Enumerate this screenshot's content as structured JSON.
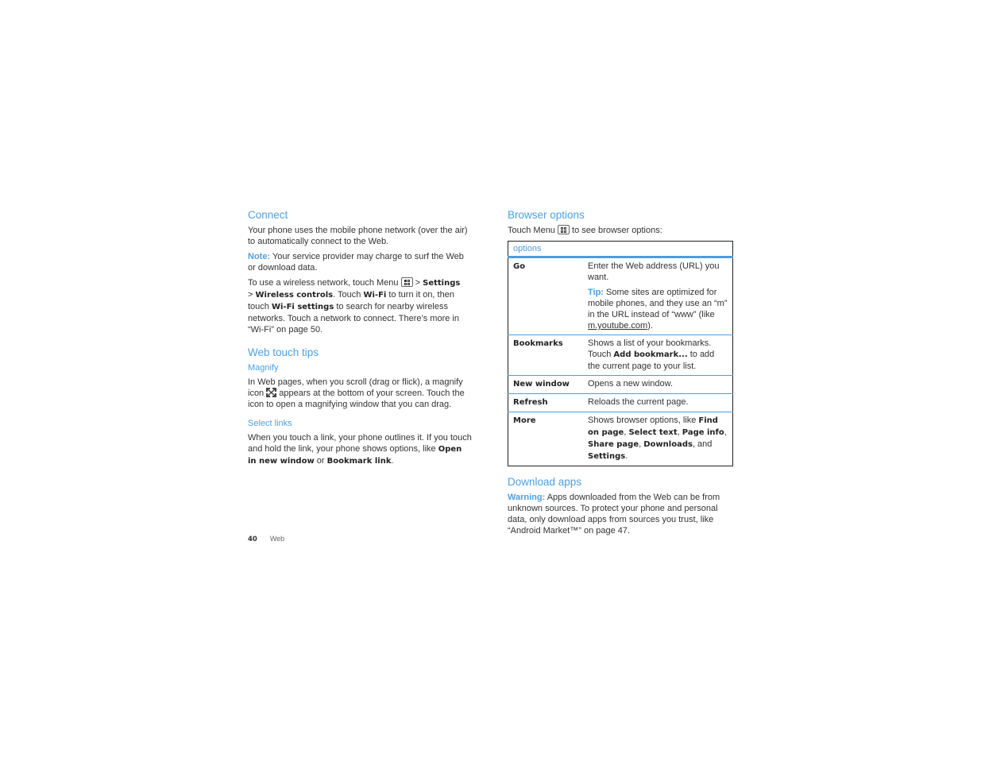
{
  "left": {
    "connect": {
      "heading": "Connect",
      "p1": "Your phone uses the mobile phone network (over the air) to automatically connect to the Web.",
      "note_label": "Note:",
      "note_text": " Your service provider may charge to surf the Web or download data.",
      "p3": {
        "t1": "To use a wireless network, touch Menu ",
        "t2": " > ",
        "b1": "Settings",
        "t3": " > ",
        "b2": "Wireless controls",
        "t4": ". Touch ",
        "b3": "Wi-Fi",
        "t5": " to turn it on, then touch ",
        "b4": "Wi-Fi settings",
        "t6": " to search for nearby wireless networks. Touch a network to connect. There’s more in “Wi-Fi” on page 50."
      }
    },
    "web_touch_tips": {
      "heading": "Web touch tips",
      "magnify": {
        "heading": "Magnify",
        "t1": "In Web pages, when you scroll (drag or flick), a magnify icon ",
        "t2": " appears at the bottom of your screen. Touch the icon to open a magnifying window that you can drag."
      },
      "select_links": {
        "heading": "Select links",
        "t1": "When you touch a link, your phone outlines it. If you touch and hold the link, your phone shows options, like ",
        "b1": "Open in new window",
        "t2": " or ",
        "b2": "Bookmark link",
        "t3": "."
      }
    }
  },
  "right": {
    "browser_options": {
      "heading": "Browser options",
      "intro1": "Touch Menu ",
      "intro2": " to see browser options:",
      "table": {
        "header": "options",
        "rows": [
          {
            "option": "Go",
            "desc": "Enter the Web address (URL) you want.",
            "tip_label": "Tip:",
            "tip_text": " Some sites are optimized for mobile phones, and they use an “m” in the URL instead of “www” (like ",
            "tip_link": "m.youtube.com",
            "tip_end": ")."
          },
          {
            "option": "Bookmarks",
            "d1": "Shows a list of your bookmarks. Touch ",
            "b1": "Add bookmark...",
            "d2": " to add the current page to your list."
          },
          {
            "option": "New window",
            "desc": "Opens a new window."
          },
          {
            "option": "Refresh",
            "desc": "Reloads the current page."
          },
          {
            "option": "More",
            "d1": "Shows browser options, like ",
            "b1": "Find on page",
            "s1": ", ",
            "b2": "Select text",
            "s2": ", ",
            "b3": "Page info",
            "s3": ", ",
            "b4": "Share page",
            "s4": ", ",
            "b5": "Downloads",
            "s5": ", and ",
            "b6": "Settings",
            "s6": "."
          }
        ]
      }
    },
    "download_apps": {
      "heading": "Download apps",
      "warning_label": "Warning:",
      "warning_text": " Apps downloaded from the Web can be from unknown sources. To protect your phone and personal data, only download apps from sources you trust, like “Android Market™” on page 47."
    }
  },
  "footer": {
    "page_number": "40",
    "section": "Web"
  },
  "icons": {
    "menu": "menu-key-icon",
    "magnify": "magnify-icon"
  },
  "colors": {
    "accent": "#4da0e0",
    "text": "#333333"
  }
}
